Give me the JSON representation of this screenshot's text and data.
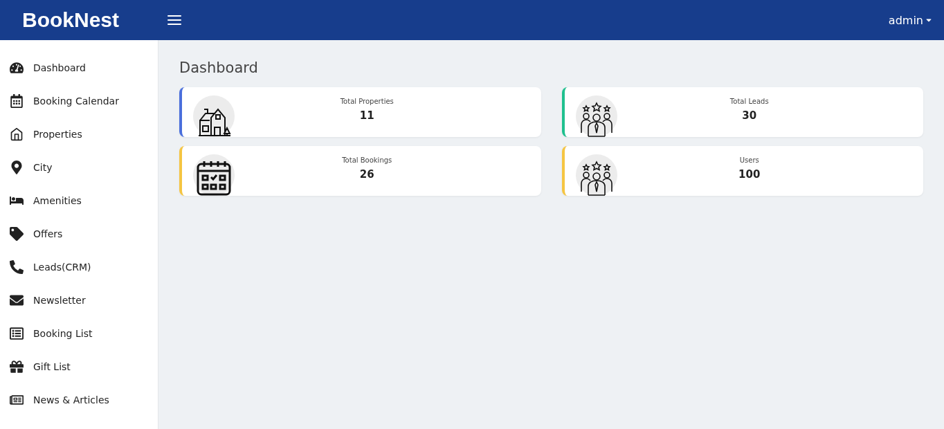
{
  "header": {
    "logo": "BookNest",
    "user_menu": "admin"
  },
  "sidebar": {
    "items": [
      {
        "label": "Dashboard"
      },
      {
        "label": "Booking Calendar"
      },
      {
        "label": "Properties"
      },
      {
        "label": "City"
      },
      {
        "label": "Amenities"
      },
      {
        "label": "Offers"
      },
      {
        "label": "Leads(CRM)"
      },
      {
        "label": "Newsletter"
      },
      {
        "label": "Booking List"
      },
      {
        "label": "Gift List"
      },
      {
        "label": "News & Articles"
      }
    ]
  },
  "page_title": "Dashboard",
  "cards": [
    {
      "label": "Total Properties",
      "value": "11",
      "color": "#4a6fdc",
      "kind": "house"
    },
    {
      "label": "Total Leads",
      "value": "30",
      "color": "#1fc08e",
      "kind": "team"
    },
    {
      "label": "Total Bookings",
      "value": "26",
      "color": "#f5c542",
      "kind": "calendar"
    },
    {
      "label": "Users",
      "value": "100",
      "color": "#f5c542",
      "kind": "team"
    }
  ]
}
